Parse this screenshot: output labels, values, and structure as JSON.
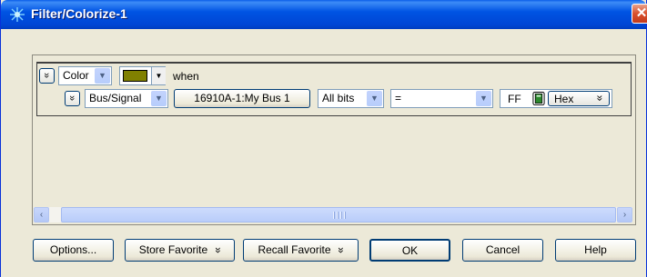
{
  "window": {
    "title": "Filter/Colorize-1",
    "close_glyph": "✕"
  },
  "rule": {
    "expand_glyph": "»",
    "action": {
      "value": "Color"
    },
    "color_swatch": {
      "color": "#808000"
    },
    "when_label": "when",
    "signal_type": {
      "value": "Bus/Signal"
    },
    "signal_button": "16910A-1:My Bus 1",
    "bits": {
      "value": "All bits"
    },
    "operator": {
      "value": "="
    },
    "value": "FF",
    "base": {
      "value": "Hex"
    }
  },
  "icons": {
    "title": "filter-icon",
    "calculator": "calculator-icon",
    "scroll_left": "scroll-left-icon",
    "scroll_right": "scroll-right-icon"
  },
  "scroll": {
    "left_glyph": "‹",
    "right_glyph": "›"
  },
  "buttons": {
    "options": "Options...",
    "store_favorite": "Store Favorite",
    "recall_favorite": "Recall Favorite",
    "ok": "OK",
    "cancel": "Cancel",
    "help": "Help"
  },
  "colors": {
    "titlebar": "#0054e3",
    "dialog_bg": "#ece9d8",
    "scroll": "#b9cdfa"
  }
}
